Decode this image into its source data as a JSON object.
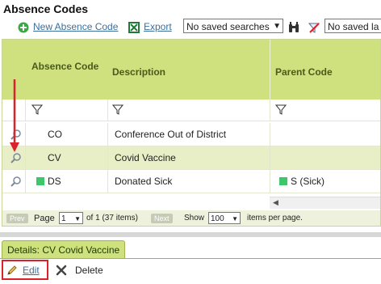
{
  "page": {
    "title": "Absence Codes"
  },
  "toolbar": {
    "new_label": "New Absence Code",
    "export_label": "Export",
    "saved_search_1": "No saved searches",
    "saved_search_2": "No saved la"
  },
  "grid": {
    "columns": [
      "Absence Code",
      "Description",
      "Parent Code"
    ],
    "rows": [
      {
        "code": "CO",
        "description": "Conference Out of District",
        "parent": "",
        "has_color": false,
        "selected": false
      },
      {
        "code": "CV",
        "description": "Covid Vaccine",
        "parent": "",
        "has_color": false,
        "selected": true
      },
      {
        "code": "DS",
        "description": "Donated Sick",
        "parent": "S (Sick)",
        "has_color": true,
        "selected": false
      }
    ],
    "pager": {
      "prev": "Prev",
      "page_label": "Page",
      "page_value": "1",
      "of_text": "of 1 (37 items)",
      "next": "Next",
      "show_label": "Show",
      "show_value": "100",
      "per_page_label": "items per page."
    }
  },
  "details": {
    "tab_label": "Details: CV Covid Vaccine",
    "edit_label": "Edit",
    "delete_label": "Delete"
  },
  "colors": {
    "header_green": "#cfe07f",
    "selected_row": "#e8efc6",
    "annotation_red": "#d9222a",
    "status_green": "#3cc86a"
  }
}
